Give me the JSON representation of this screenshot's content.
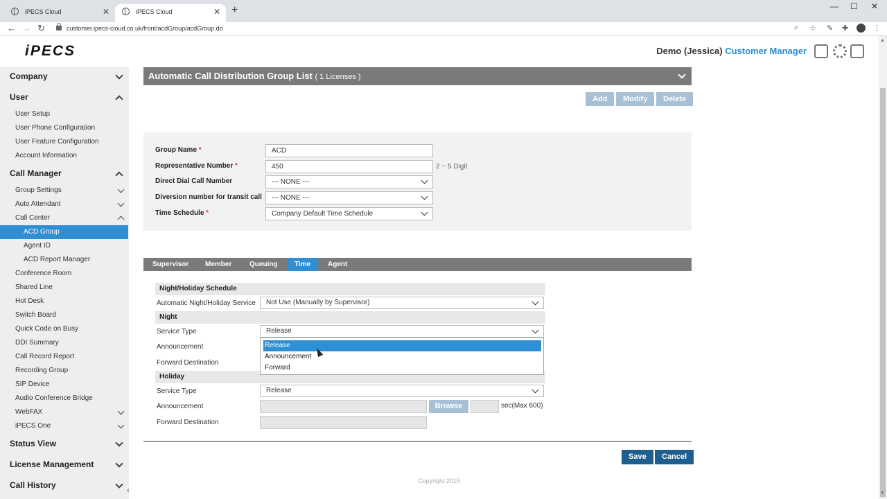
{
  "browser": {
    "tabs": [
      {
        "title": "iPECS Cloud"
      },
      {
        "title": "iPECS Cloud"
      }
    ],
    "url": "customer.ipecs-cloud.co.uk/front/acdGroup/acdGroup.do",
    "new_tab": "+",
    "minimize": "—",
    "maximize": "☐",
    "close": "✕"
  },
  "header": {
    "logo": "iPECS",
    "user_name": "Demo (Jessica)",
    "user_role": "Customer Manager",
    "icons": [
      "manual-icon",
      "gear-icon",
      "logout-icon"
    ]
  },
  "sidebar": {
    "sections": [
      {
        "label": "Company",
        "expanded": false
      },
      {
        "label": "User",
        "expanded": true
      },
      {
        "label": "Call Manager",
        "expanded": true
      },
      {
        "label": "Status View",
        "expanded": false
      },
      {
        "label": "License Management",
        "expanded": false
      },
      {
        "label": "Call History",
        "expanded": false
      }
    ],
    "user_items": [
      "User Setup",
      "User Phone Configuration",
      "User Feature Configuration",
      "Account Information"
    ],
    "call_manager_items": [
      {
        "label": "Group Settings",
        "chevron": "down"
      },
      {
        "label": "Auto Attendant",
        "chevron": "down"
      },
      {
        "label": "Call Center",
        "chevron": "up"
      },
      {
        "label": "ACD Group",
        "sub": true,
        "active": true
      },
      {
        "label": "Agent ID",
        "sub": true
      },
      {
        "label": "ACD Report Manager",
        "sub": true
      },
      {
        "label": "Conference Room"
      },
      {
        "label": "Shared Line"
      },
      {
        "label": "Hot Desk"
      },
      {
        "label": "Switch Board"
      },
      {
        "label": "Quick Code on Busy"
      },
      {
        "label": "DDI Summary"
      },
      {
        "label": "Call Record Report"
      },
      {
        "label": "Recording Group"
      },
      {
        "label": "SIP Device"
      },
      {
        "label": "Audio Conference Bridge"
      },
      {
        "label": "WebFAX",
        "chevron": "down"
      },
      {
        "label": "iPECS One",
        "chevron": "down"
      }
    ]
  },
  "main": {
    "title": "Automatic Call Distribution Group List",
    "licenses": "( 1 Licenses )",
    "buttons": {
      "add": "Add",
      "modify": "Modify",
      "delete": "Delete"
    },
    "form": {
      "group_name_label": "Group Name",
      "group_name_value": "ACD",
      "rep_number_label": "Representative Number",
      "rep_number_value": "450",
      "rep_number_hint": "2 ~ 5 Digit",
      "direct_dial_label": "Direct Dial Call Number",
      "direct_dial_value": "--- NONE ---",
      "diversion_label": "Diversion number for transit call",
      "diversion_value": "--- NONE ---",
      "time_schedule_label": "Time Schedule",
      "time_schedule_value": "Company Default Time Schedule",
      "required_mark": "*"
    },
    "tabs": [
      "Supervisor",
      "Member",
      "Queuing",
      "Time",
      "Agent"
    ],
    "active_tab": "Time",
    "time": {
      "night_holiday_header": "Night/Holiday Schedule",
      "auto_service_label": "Automatic Night/Holiday Service",
      "auto_service_value": "Not Use (Manually by Supervisor)",
      "night_header": "Night",
      "night_service_type_label": "Service Type",
      "night_service_type_value": "Release",
      "night_announcement_label": "Announcement",
      "night_forward_label": "Forward Destination",
      "dropdown_options": [
        "Release",
        "Announcement",
        "Forward"
      ],
      "dropdown_selected": "Release",
      "holiday_header": "Holiday",
      "holiday_service_type_label": "Service Type",
      "holiday_service_type_value": "Release",
      "holiday_announcement_label": "Announcement",
      "browse_label": "Browse",
      "sec_max": "sec(Max 600)",
      "holiday_forward_label": "Forward Destination"
    },
    "save": "Save",
    "cancel": "Cancel",
    "copyright": "Copyright 2015"
  },
  "colors": {
    "accent": "#2e8fd4",
    "header_bar": "#7a7a7a",
    "disabled_button": "#a8c0d6",
    "primary_button": "#1f5f8f",
    "role_text": "#2a8bd0"
  }
}
